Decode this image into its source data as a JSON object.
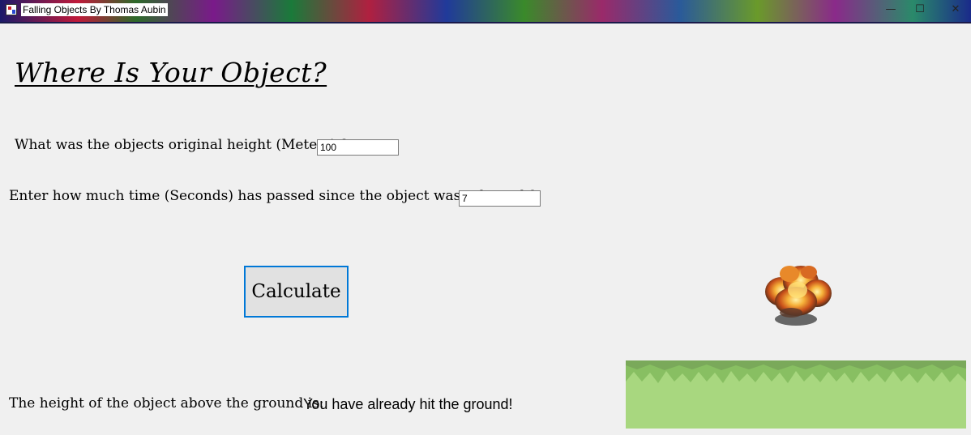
{
  "window": {
    "title": "Falling Objects By Thomas Aubin",
    "controls": {
      "minimize": "—",
      "maximize": "☐",
      "close": "✕"
    }
  },
  "heading": "Where Is Your Object?",
  "height_question": {
    "label": "What was the objects original height (Meters) ?",
    "value": "100"
  },
  "time_question": {
    "label": "Enter how much time (Seconds) has passed since the object was released ?",
    "value": "7"
  },
  "calculate_button": "Calculate",
  "result": {
    "label": "The height of the object above the ground is:",
    "value": "You have already hit the ground!"
  },
  "icons": {
    "window_icon": "app-icon",
    "explosion": "explosion-image",
    "ground": "grass-ground-image"
  },
  "colors": {
    "background": "#f0f0f0",
    "button_border": "#0078d7",
    "grass": "#a8d77f",
    "grass_dark": "#7fb85c"
  }
}
